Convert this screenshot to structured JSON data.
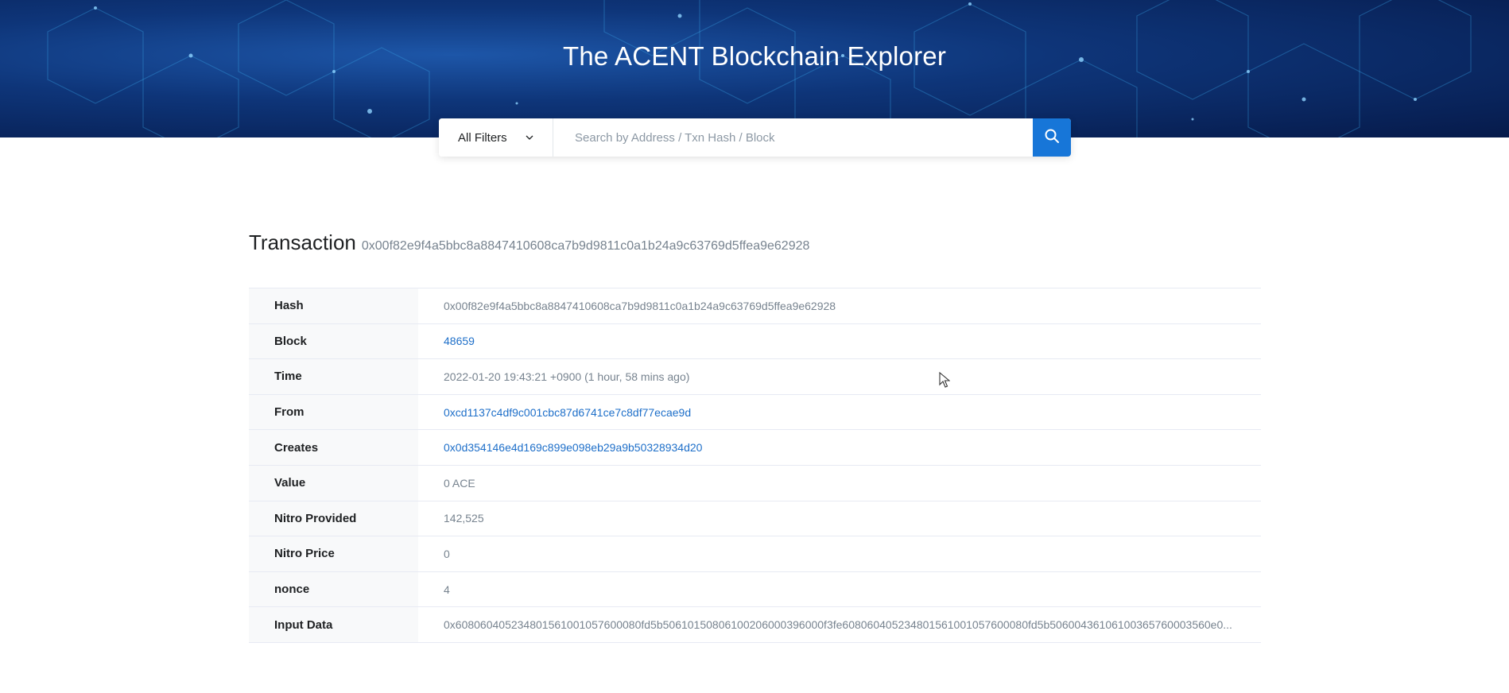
{
  "header": {
    "title": "The ACENT Blockchain Explorer"
  },
  "search": {
    "filter_label": "All Filters",
    "placeholder": "Search by Address / Txn Hash / Block"
  },
  "transaction": {
    "heading": "Transaction",
    "hash": "0x00f82e9f4a5bbc8a8847410608ca7b9d9811c0a1b24a9c63769d5ffea9e62928"
  },
  "details": {
    "hash": {
      "label": "Hash",
      "value": "0x00f82e9f4a5bbc8a8847410608ca7b9d9811c0a1b24a9c63769d5ffea9e62928"
    },
    "block": {
      "label": "Block",
      "value": "48659"
    },
    "time": {
      "label": "Time",
      "value": "2022-01-20 19:43:21 +0900 (1 hour, 58 mins ago)"
    },
    "from": {
      "label": "From",
      "value": "0xcd1137c4df9c001cbc87d6741ce7c8df77ecae9d"
    },
    "creates": {
      "label": "Creates",
      "value": "0x0d354146e4d169c899e098eb29a9b50328934d20"
    },
    "value": {
      "label": "Value",
      "value": "0 ACE"
    },
    "nitro_provided": {
      "label": "Nitro Provided",
      "value": "142,525"
    },
    "nitro_price": {
      "label": "Nitro Price",
      "value": "0"
    },
    "nonce": {
      "label": "nonce",
      "value": "4"
    },
    "input_data": {
      "label": "Input Data",
      "value": "0x608060405234801561001057600080fd5b50610150806100206000396000f3fe608060405234801561001057600080fd5b50600436106100365760003560e0..."
    }
  },
  "colors": {
    "accent": "#1776d8",
    "link": "#1e6fc9",
    "hero_dark": "#061a4a",
    "label_bg": "#f8f9fa"
  }
}
